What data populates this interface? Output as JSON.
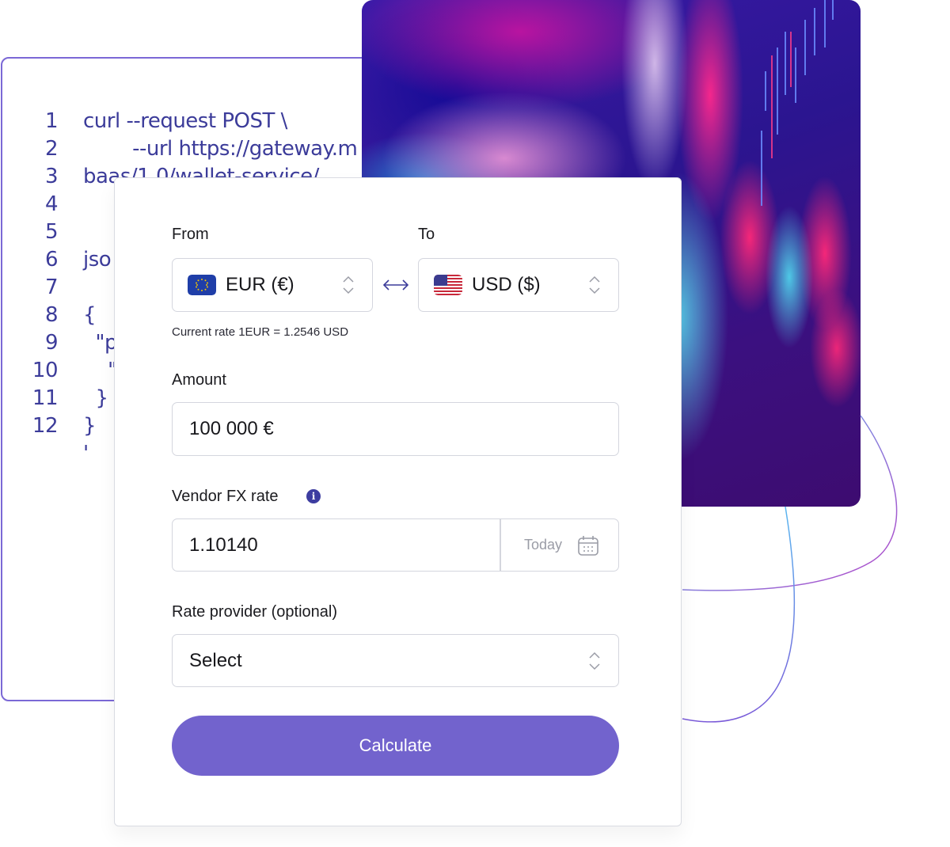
{
  "code": {
    "lines": [
      {
        "num": "1",
        "text": "curl --request POST \\"
      },
      {
        "num": "2",
        "text": "        --url https://gateway.m"
      },
      {
        "num": "3",
        "text": "baas/1.0/wallet-service/"
      },
      {
        "num": "4",
        "text": ""
      },
      {
        "num": "5",
        "text": ""
      },
      {
        "num": "6",
        "text": "jso"
      },
      {
        "num": "7",
        "text": ""
      },
      {
        "num": "8",
        "text": "{"
      },
      {
        "num": "9",
        "text": "  \"p"
      },
      {
        "num": "10",
        "text": "    \""
      },
      {
        "num": "11",
        "text": "  }"
      },
      {
        "num": "12",
        "text": "}"
      },
      {
        "num": "",
        "text": "'"
      }
    ]
  },
  "form": {
    "from_label": "From",
    "to_label": "To",
    "from_currency": {
      "value": "EUR (€)",
      "flag": "eu-flag-icon"
    },
    "to_currency": {
      "value": "USD ($)",
      "flag": "us-flag-icon"
    },
    "swap_icon": "swap-arrows-icon",
    "current_rate": "Current rate 1EUR = 1.2546 USD",
    "amount_label": "Amount",
    "amount_value": "100 000 €",
    "vendor_fx_label": "Vendor FX rate",
    "vendor_fx_info_icon": "i",
    "vendor_fx_value": "1.10140",
    "vendor_fx_date": "Today",
    "rate_provider_label": "Rate provider (optional)",
    "rate_provider_value": "Select",
    "calculate_label": "Calculate"
  },
  "colors": {
    "accent": "#7263cd",
    "code_text": "#3c3c9a",
    "code_border": "#7b68d6",
    "info_icon": "#3d3da0"
  }
}
